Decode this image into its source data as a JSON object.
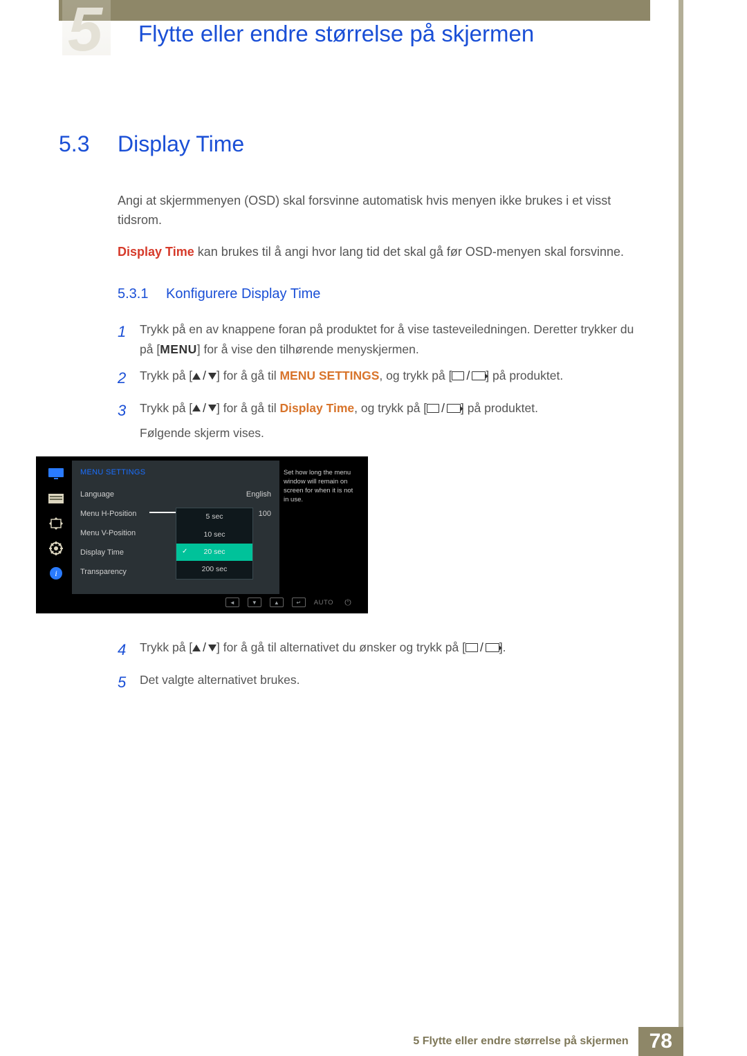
{
  "chapter": {
    "number": "5",
    "title": "Flytte eller endre størrelse på skjermen"
  },
  "section": {
    "number": "5.3",
    "title": "Display Time",
    "intro1": "Angi at skjermmenyen (OSD) skal forsvinne automatisk hvis menyen ikke brukes i et visst tidsrom.",
    "intro2_bold": "Display Time",
    "intro2_rest": " kan brukes til å angi hvor lang tid det skal gå før OSD-menyen skal forsvinne."
  },
  "subsection": {
    "number": "5.3.1",
    "title": "Konfigurere Display Time"
  },
  "steps": {
    "s1a": "Trykk på en av knappene foran på produktet for å vise tasteveiledningen. Deretter trykker du på [",
    "s1_menu": "MENU",
    "s1b": "] for å vise den tilhørende menyskjermen.",
    "s2a": "Trykk på [",
    "s2b": "] for å gå til ",
    "s2_target": "MENU SETTINGS",
    "s2c": ", og trykk på [",
    "s2d": "] på produktet.",
    "s3a": "Trykk på [",
    "s3b": "] for å gå til ",
    "s3_target": "Display Time",
    "s3c": ", og trykk på [",
    "s3d": "] på produktet.",
    "s3e": "Følgende skjerm vises.",
    "s4a": "Trykk på [",
    "s4b": "] for å gå til alternativet du ønsker og trykk på [",
    "s4c": "].",
    "s5": "Det valgte alternativet brukes."
  },
  "osd": {
    "title": "MENU SETTINGS",
    "rows": {
      "language_label": "Language",
      "language_value": "English",
      "hpos_label": "Menu H-Position",
      "hpos_value": "100",
      "vpos_label": "Menu V-Position",
      "dtime_label": "Display Time",
      "transp_label": "Transparency"
    },
    "options": [
      "5 sec",
      "10 sec",
      "20 sec",
      "200 sec"
    ],
    "selected_index": 2,
    "help": "Set how long the menu window will remain on screen for when it is not in use.",
    "footer_auto": "AUTO"
  },
  "footer": {
    "text": "5 Flytte eller endre størrelse på skjermen",
    "page": "78"
  }
}
